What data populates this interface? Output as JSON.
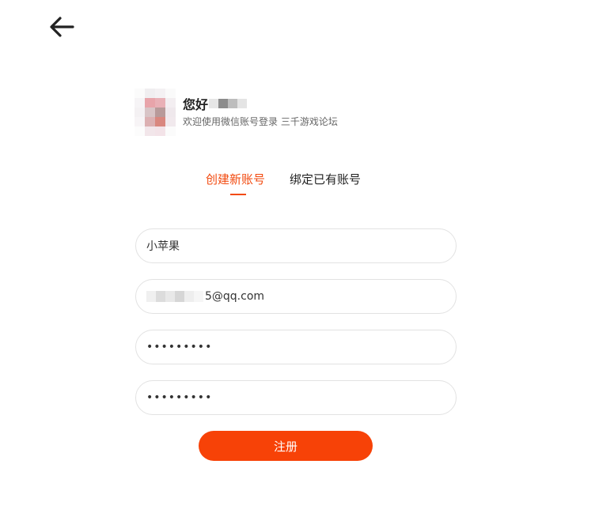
{
  "header": {
    "back_icon": "arrow-left-icon"
  },
  "profile": {
    "greeting": "您好",
    "welcome": "欢迎使用微信账号登录 三千游戏论坛"
  },
  "tabs": [
    {
      "label": "创建新账号",
      "active": true
    },
    {
      "label": "绑定已有账号",
      "active": false
    }
  ],
  "form": {
    "nickname_value": "小苹果",
    "email_visible_suffix": "5@qq.com",
    "password_masked": "•••••••••",
    "confirm_password_masked": "•••••••••"
  },
  "register_button": {
    "label": "注册"
  },
  "colors": {
    "accent": "#f24a0f",
    "button": "#f74207",
    "border": "#e2e2e2"
  }
}
